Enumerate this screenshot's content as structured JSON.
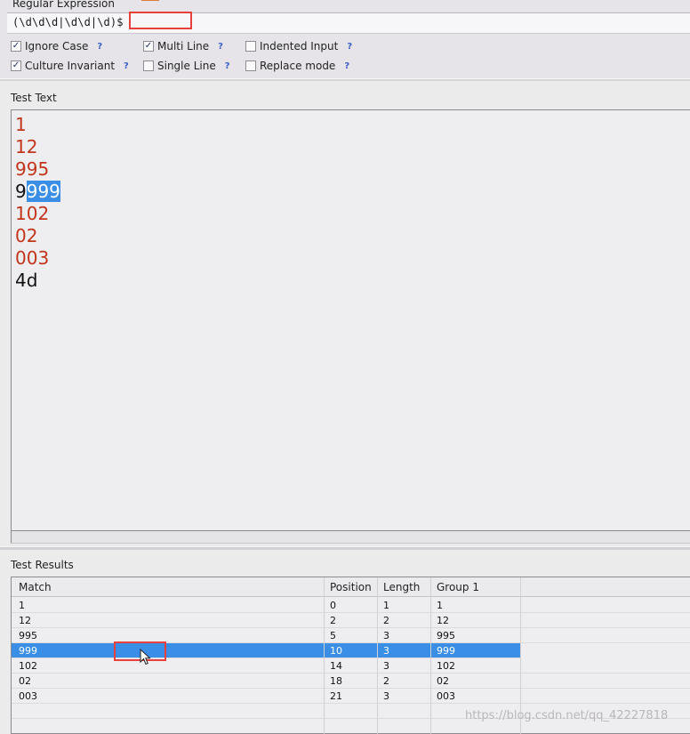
{
  "regex_panel": {
    "title": "Regular Expression",
    "pattern": "(\\d\\d\\d|\\d\\d|\\d)$"
  },
  "options": [
    {
      "label": "Ignore Case",
      "checked": true,
      "help": "?"
    },
    {
      "label": "Multi Line",
      "checked": true,
      "help": "?"
    },
    {
      "label": "Indented Input",
      "checked": false,
      "help": "?"
    },
    {
      "label": "Culture Invariant",
      "checked": true,
      "help": "?"
    },
    {
      "label": "Single Line",
      "checked": false,
      "help": "?"
    },
    {
      "label": "Replace mode",
      "checked": false,
      "help": "?"
    }
  ],
  "test_text": {
    "title": "Test Text",
    "lines": [
      {
        "pre": "",
        "match": "1",
        "selected": false
      },
      {
        "pre": "",
        "match": "12",
        "selected": false
      },
      {
        "pre": "",
        "match": "995",
        "selected": false
      },
      {
        "pre": "9",
        "match": "999",
        "selected": true
      },
      {
        "pre": "",
        "match": "102",
        "selected": false
      },
      {
        "pre": "",
        "match": "02",
        "selected": false
      },
      {
        "pre": "",
        "match": "003",
        "selected": false
      },
      {
        "pre": "4d",
        "match": "",
        "selected": false
      }
    ]
  },
  "results": {
    "title": "Test Results",
    "columns": [
      "Match",
      "Position",
      "Length",
      "Group 1"
    ],
    "rows": [
      [
        "1",
        "0",
        "1",
        "1"
      ],
      [
        "12",
        "2",
        "2",
        "12"
      ],
      [
        "995",
        "5",
        "3",
        "995"
      ],
      [
        "999",
        "10",
        "3",
        "999"
      ],
      [
        "102",
        "14",
        "3",
        "102"
      ],
      [
        "02",
        "18",
        "2",
        "02"
      ],
      [
        "003",
        "21",
        "3",
        "003"
      ]
    ],
    "selected_row": 3
  },
  "watermark": "https://blog.csdn.net/qq_42227818",
  "colors": {
    "match_text": "#c2351b",
    "selection": "#3a8ee6",
    "annotation_marker": "#e8403b"
  },
  "icons": {
    "cursor": "mouse-pointer-icon"
  }
}
